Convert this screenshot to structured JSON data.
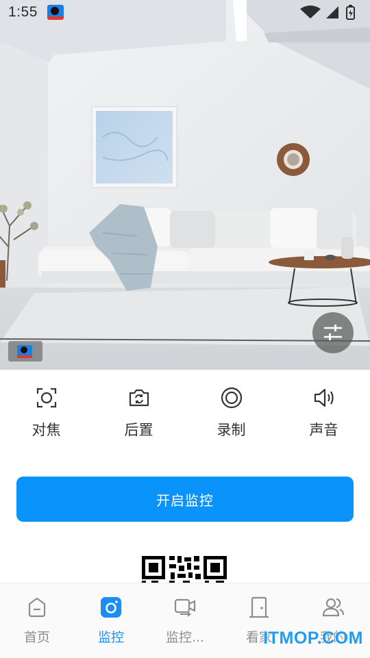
{
  "status_bar": {
    "time": "1:55"
  },
  "preview": {
    "description_icon": "camera-preview"
  },
  "controls": [
    {
      "label": "对焦",
      "icon": "focus-icon"
    },
    {
      "label": "后置",
      "icon": "camera-switch-icon"
    },
    {
      "label": "录制",
      "icon": "record-icon"
    },
    {
      "label": "声音",
      "icon": "speaker-icon"
    }
  ],
  "start_button": {
    "label": "开启监控"
  },
  "bottom_nav": [
    {
      "label": "首页",
      "icon": "home-icon",
      "active": false
    },
    {
      "label": "监控",
      "icon": "camera-icon",
      "active": true
    },
    {
      "label": "监控...",
      "icon": "video-monitor-icon",
      "active": false
    },
    {
      "label": "看家",
      "icon": "door-icon",
      "active": false
    },
    {
      "label": "我的",
      "icon": "users-icon",
      "active": false
    }
  ],
  "watermark": "ITMOP.COM",
  "colors": {
    "accent": "#0a93fa",
    "nav_active": "#1a8ef5",
    "nav_inactive": "#8d8d8d"
  }
}
